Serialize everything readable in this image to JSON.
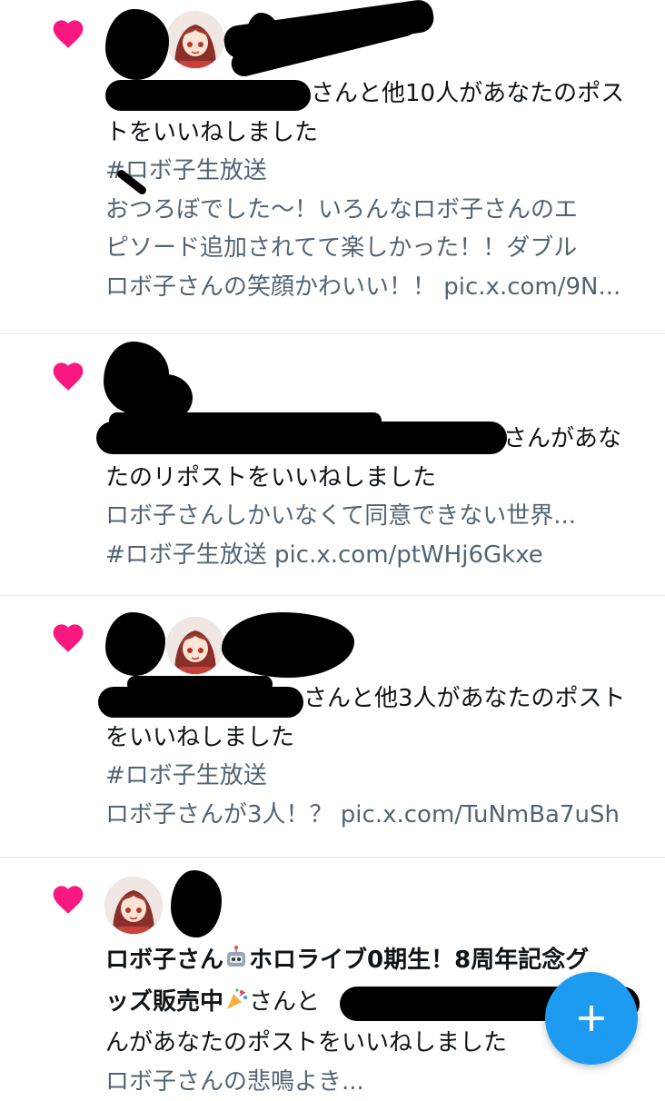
{
  "colors": {
    "heart": "#f91880",
    "text_primary": "#0f1419",
    "text_secondary": "#536471",
    "fab": "#1d9bf0",
    "divider": "#e6e6e6"
  },
  "notifications": [
    {
      "icon": "heart-icon",
      "message_line_1": "さんと他10人があなたのポス",
      "message_line_2": "トをいいねしました",
      "preview_line_1": "#ロボ子生放送",
      "preview_line_2": "おつろぼでした〜！いろんなロボ子さんのエ",
      "preview_line_3": "ピソード追加されてて楽しかった！！ダブル",
      "preview_line_4": "ロボ子さんの笑顔かわいい！！ pic.x.com/9N..."
    },
    {
      "icon": "heart-icon",
      "message_line_1": "さんがあな",
      "message_line_2": "たのリポストをいいねしました",
      "preview_line_1": "ロボ子さんしかいなくて同意できない世界...",
      "preview_line_2": "#ロボ子生放送 pic.x.com/ptWHj6Gkxe"
    },
    {
      "icon": "heart-icon",
      "message_line_1": "さんと他3人があなたのポスト",
      "message_line_2": "をいいねしました",
      "preview_line_1": "#ロボ子生放送",
      "preview_line_2": "ロボ子さんが3人！？ pic.x.com/TuNmBa7uSh"
    },
    {
      "icon": "heart-icon",
      "name_part_1": "ロボ子さん",
      "name_emoji_1": "robot-emoji",
      "name_part_2": "ホロライブ0期生！8周年記念グ",
      "name_part_3": "ッズ販売中",
      "name_emoji_2": "party-popper-emoji",
      "message_line_1_suffix": "さんと",
      "message_line_2": "んがあなたのポストをいいねしました",
      "preview_line_1": "ロボ子さんの悲鳴よき..."
    }
  ],
  "compose_button": {
    "icon": "plus-icon"
  }
}
